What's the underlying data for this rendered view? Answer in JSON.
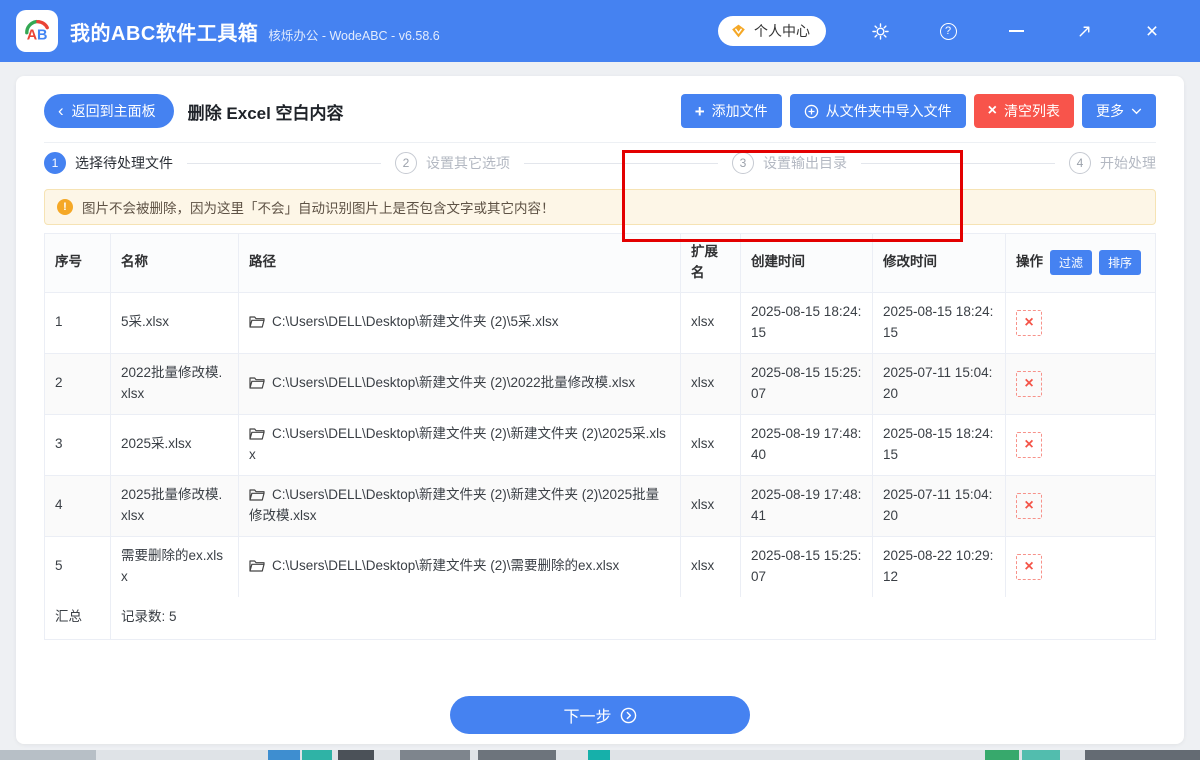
{
  "titlebar": {
    "logo_text_a": "A",
    "logo_text_b": "B",
    "app_title": "我的ABC软件工具箱",
    "app_subtitle": "核烁办公 - WodeABC - v6.58.6",
    "account_label": "个人中心"
  },
  "icons": {
    "back_chevron": "‹",
    "plus": "+",
    "clear_x": "×",
    "close_x": "×",
    "help": "?",
    "warning": "!",
    "delete_x": "×"
  },
  "toolbar": {
    "back_label": "返回到主面板",
    "page_title": "删除 Excel 空白内容",
    "add_files_label": "添加文件",
    "import_folder_label": "从文件夹中导入文件",
    "clear_list_label": "清空列表",
    "more_label": "更多"
  },
  "steps": [
    {
      "num": "1",
      "label": "选择待处理文件"
    },
    {
      "num": "2",
      "label": "设置其它选项"
    },
    {
      "num": "3",
      "label": "设置输出目录"
    },
    {
      "num": "4",
      "label": "开始处理"
    }
  ],
  "alert": {
    "text": "图片不会被删除，因为这里「不会」自动识别图片上是否包含文字或其它内容！"
  },
  "table": {
    "headers": {
      "index": "序号",
      "name": "名称",
      "path": "路径",
      "ext": "扩展名",
      "created": "创建时间",
      "modified": "修改时间",
      "actions": "操作"
    },
    "filter_label": "过滤",
    "sort_label": "排序",
    "rows": [
      {
        "index": "1",
        "name": "5采.xlsx",
        "path": "C:\\Users\\DELL\\Desktop\\新建文件夹 (2)\\5采.xlsx",
        "ext": "xlsx",
        "created": "2025-08-15 18:24:15",
        "modified": "2025-08-15 18:24:15"
      },
      {
        "index": "2",
        "name": "2022批量修改模.xlsx",
        "path": "C:\\Users\\DELL\\Desktop\\新建文件夹 (2)\\2022批量修改模.xlsx",
        "ext": "xlsx",
        "created": "2025-08-15 15:25:07",
        "modified": "2025-07-11 15:04:20"
      },
      {
        "index": "3",
        "name": "2025采.xlsx",
        "path": "C:\\Users\\DELL\\Desktop\\新建文件夹 (2)\\新建文件夹 (2)\\2025采.xlsx",
        "ext": "xlsx",
        "created": "2025-08-19 17:48:40",
        "modified": "2025-08-15 18:24:15"
      },
      {
        "index": "4",
        "name": "2025批量修改模.xlsx",
        "path": "C:\\Users\\DELL\\Desktop\\新建文件夹 (2)\\新建文件夹 (2)\\2025批量修改模.xlsx",
        "ext": "xlsx",
        "created": "2025-08-19 17:48:41",
        "modified": "2025-07-11 15:04:20"
      },
      {
        "index": "5",
        "name": "需要删除的ex.xlsx",
        "path": "C:\\Users\\DELL\\Desktop\\新建文件夹 (2)\\需要删除的ex.xlsx",
        "ext": "xlsx",
        "created": "2025-08-15 15:25:07",
        "modified": "2025-08-22 10:29:12"
      }
    ],
    "summary_label": "汇总",
    "summary_text": "记录数: 5"
  },
  "footer": {
    "next_label": "下一步"
  },
  "colors": {
    "accent_blue": "#4582f1",
    "danger_red": "#f8544b",
    "annotation_red": "#e30000",
    "warning_bg": "#fdf6e7",
    "warning_icon": "#f5a826"
  }
}
